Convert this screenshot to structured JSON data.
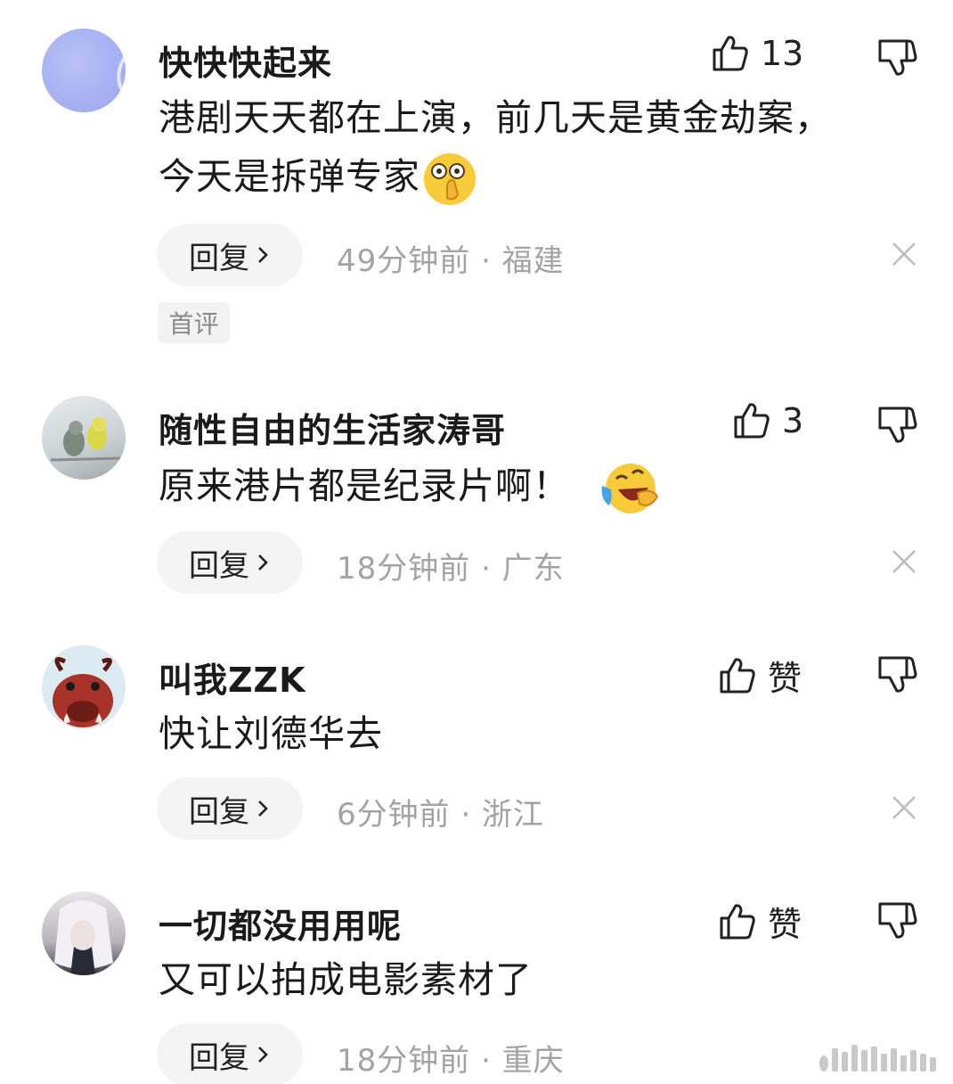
{
  "comments": [
    {
      "username": "快快快起来",
      "text_lines": [
        "港剧天天都在上演，前几天是黄金劫案，",
        "今天是拆弹专家"
      ],
      "like_label": "13",
      "reply_label": "回复",
      "meta": "49分钟前 · 福建",
      "badge": "首评",
      "avatar_color": "#a9b3f2",
      "emoji": "face-with-hand-over-mouth-emoji"
    },
    {
      "username": "随性自由的生活家涛哥",
      "text_lines": [
        "原来港片都是纪录片啊！"
      ],
      "like_label": "3",
      "reply_label": "回复",
      "meta": "18分钟前 · 广东",
      "emoji": "laughing-crying-emoji"
    },
    {
      "username": "叫我ZZK",
      "text_lines": [
        "快让刘德华去"
      ],
      "like_label": "赞",
      "reply_label": "回复",
      "meta": "6分钟前 · 浙江"
    },
    {
      "username": "一切都没用用呢",
      "text_lines": [
        "又可以拍成电影素材了"
      ],
      "like_label": "赞",
      "reply_label": "回复",
      "meta": "18分钟前 · 重庆"
    }
  ],
  "colors": {
    "text": "#1a1a1a",
    "meta": "#a3a3a3",
    "reply_bg": "#f4f4f5"
  }
}
